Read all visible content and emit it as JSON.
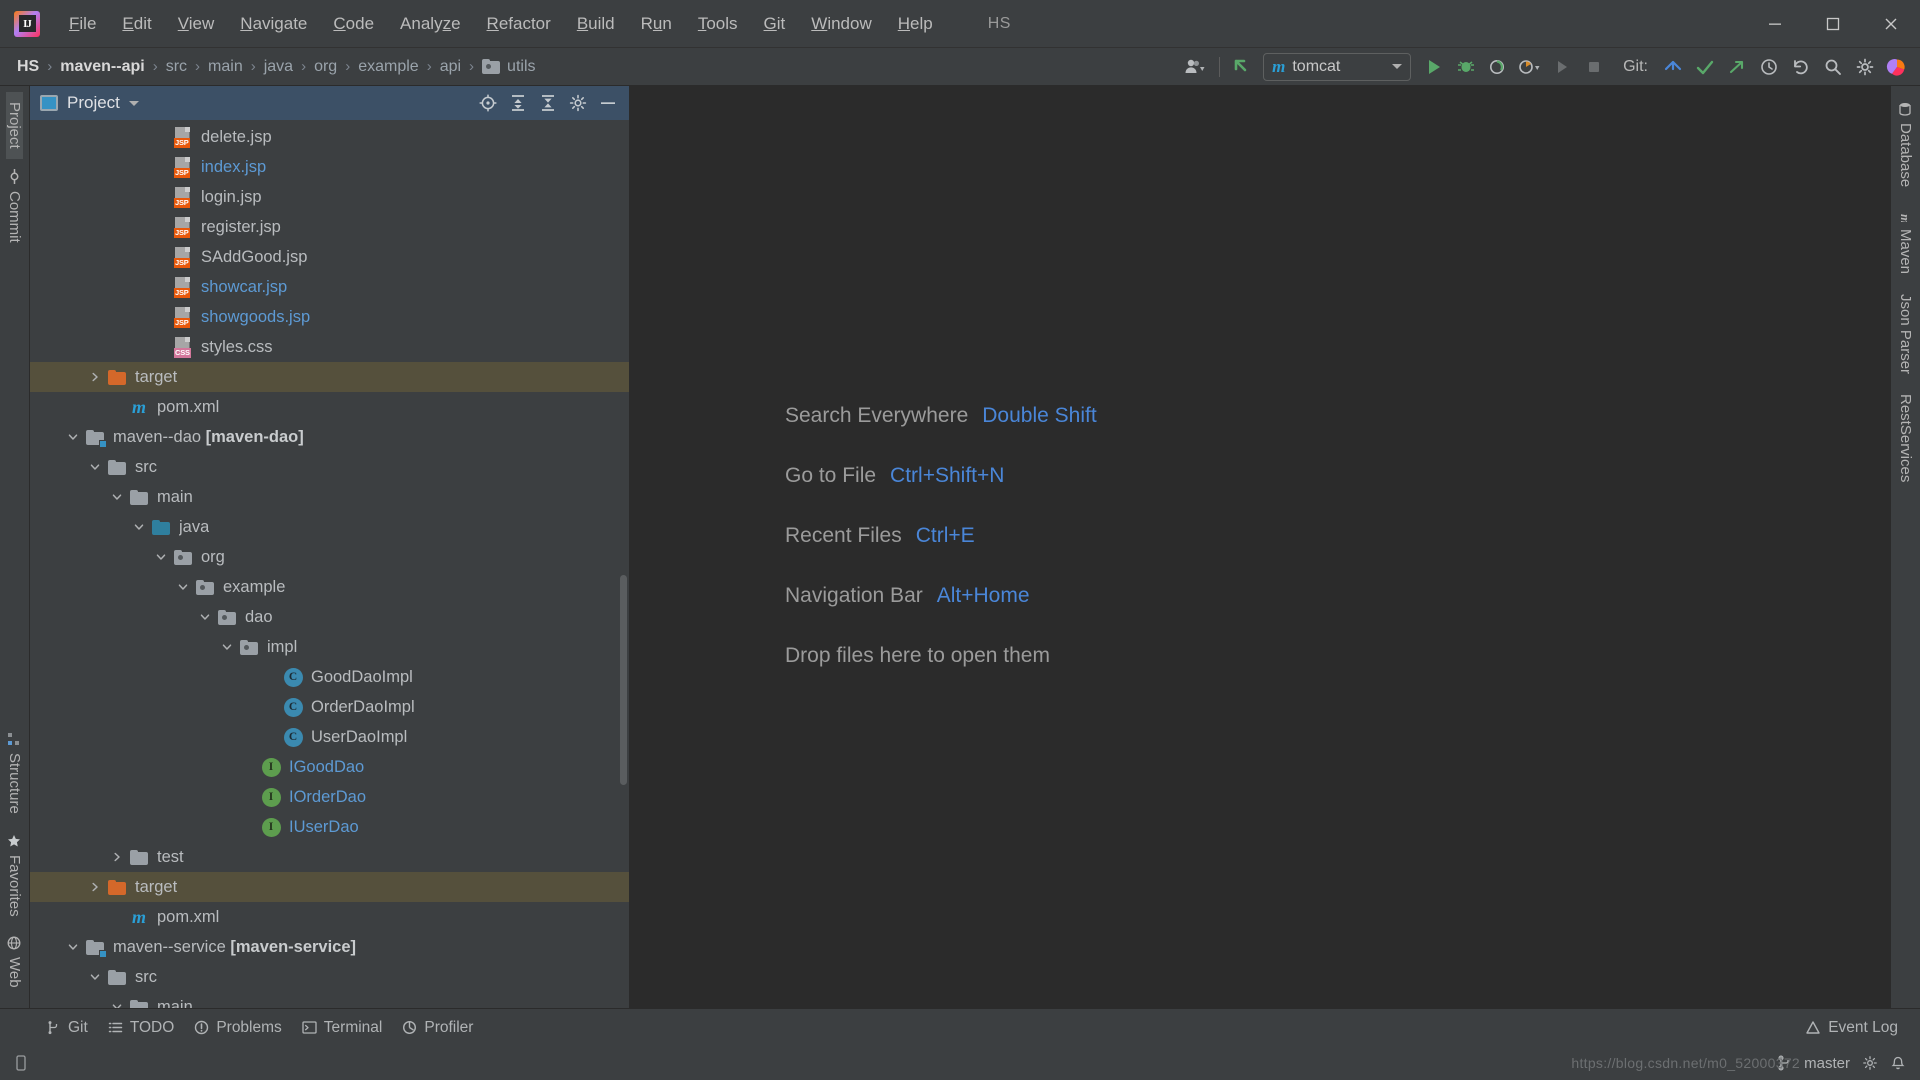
{
  "app": {
    "logo_text": "IJ",
    "project_name": "HS"
  },
  "menubar": {
    "items": [
      {
        "label": "File",
        "mnemonic": "F"
      },
      {
        "label": "Edit",
        "mnemonic": "E"
      },
      {
        "label": "View",
        "mnemonic": "V"
      },
      {
        "label": "Navigate",
        "mnemonic": "N"
      },
      {
        "label": "Code",
        "mnemonic": "C"
      },
      {
        "label": "Analyze",
        "mnemonic": "z"
      },
      {
        "label": "Refactor",
        "mnemonic": "R"
      },
      {
        "label": "Build",
        "mnemonic": "B"
      },
      {
        "label": "Run",
        "mnemonic": "u"
      },
      {
        "label": "Tools",
        "mnemonic": "T"
      },
      {
        "label": "Git",
        "mnemonic": "G"
      },
      {
        "label": "Window",
        "mnemonic": "W"
      },
      {
        "label": "Help",
        "mnemonic": "H"
      }
    ],
    "window_controls": {
      "minimize": "─",
      "maximize": "❐",
      "close": "✕"
    }
  },
  "navbar": {
    "breadcrumbs": [
      {
        "label": "HS",
        "style": "strong"
      },
      {
        "label": "maven--api",
        "style": "strong"
      },
      {
        "label": "src",
        "style": "dim"
      },
      {
        "label": "main",
        "style": "dim"
      },
      {
        "label": "java",
        "style": "dim"
      },
      {
        "label": "org",
        "style": "dim"
      },
      {
        "label": "example",
        "style": "dim"
      },
      {
        "label": "api",
        "style": "dim"
      },
      {
        "label": "utils",
        "style": "dim",
        "icon": "folder-icon"
      }
    ],
    "separator": "›",
    "run_config": {
      "name": "tomcat",
      "icon": "maven-m-icon"
    },
    "git_label": "Git:",
    "icons": [
      "user-dropdown-icon",
      "update-project-icon",
      "run-icon",
      "debug-icon",
      "run-with-coverage-icon",
      "profile-icon",
      "rerun-icon",
      "stop-icon",
      "git-update-icon",
      "git-commit-icon",
      "git-push-icon",
      "history-icon",
      "rollback-icon",
      "search-icon",
      "settings-icon",
      "ide-icon"
    ]
  },
  "left_rail": {
    "top_items": [
      "Project",
      "Commit"
    ],
    "bottom_items": [
      "Structure",
      "Favorites",
      "Web"
    ]
  },
  "right_rail": {
    "items": [
      "Database",
      "Maven",
      "Json Parser",
      "RestServices"
    ]
  },
  "project_window": {
    "title": "Project",
    "tools": [
      "locate-icon",
      "expand-all-icon",
      "collapse-all-icon",
      "settings-icon",
      "hide-icon"
    ],
    "tree": [
      {
        "label": "delete.jsp",
        "indent": 5,
        "icon": "jsp-file-icon",
        "arrow": "none",
        "color": "grey"
      },
      {
        "label": "index.jsp",
        "indent": 5,
        "icon": "jsp-file-icon",
        "arrow": "none",
        "color": "blue"
      },
      {
        "label": "login.jsp",
        "indent": 5,
        "icon": "jsp-file-icon",
        "arrow": "none",
        "color": "grey"
      },
      {
        "label": "register.jsp",
        "indent": 5,
        "icon": "jsp-file-icon",
        "arrow": "none",
        "color": "grey"
      },
      {
        "label": "SAddGood.jsp",
        "indent": 5,
        "icon": "jsp-file-icon",
        "arrow": "none",
        "color": "grey"
      },
      {
        "label": "showcar.jsp",
        "indent": 5,
        "icon": "jsp-file-icon",
        "arrow": "none",
        "color": "blue"
      },
      {
        "label": "showgoods.jsp",
        "indent": 5,
        "icon": "jsp-file-icon",
        "arrow": "none",
        "color": "blue"
      },
      {
        "label": "styles.css",
        "indent": 5,
        "icon": "css-file-icon",
        "arrow": "none",
        "color": "grey"
      },
      {
        "label": "target",
        "indent": 2,
        "icon": "folder-orange-icon",
        "arrow": "collapsed",
        "color": "grey",
        "highlighted": true
      },
      {
        "label": "pom.xml",
        "indent": 3,
        "icon": "maven-m-icon",
        "arrow": "none",
        "color": "grey"
      },
      {
        "label": "maven--dao ",
        "bold": "[maven-dao]",
        "indent": 1,
        "icon": "module-icon",
        "arrow": "expanded",
        "color": "grey"
      },
      {
        "label": "src",
        "indent": 2,
        "icon": "folder-icon",
        "arrow": "expanded",
        "color": "grey"
      },
      {
        "label": "main",
        "indent": 3,
        "icon": "folder-icon",
        "arrow": "expanded",
        "color": "grey"
      },
      {
        "label": "java",
        "indent": 4,
        "icon": "folder-blue-icon",
        "arrow": "expanded",
        "color": "grey"
      },
      {
        "label": "org",
        "indent": 5,
        "icon": "package-icon",
        "arrow": "expanded",
        "color": "grey"
      },
      {
        "label": "example",
        "indent": 6,
        "icon": "package-icon",
        "arrow": "expanded",
        "color": "grey"
      },
      {
        "label": "dao",
        "indent": 7,
        "icon": "package-icon",
        "arrow": "expanded",
        "color": "grey"
      },
      {
        "label": "impl",
        "indent": 8,
        "icon": "package-icon",
        "arrow": "expanded",
        "color": "grey"
      },
      {
        "label": "GoodDaoImpl",
        "indent": 10,
        "icon": "class-icon",
        "arrow": "none",
        "color": "grey"
      },
      {
        "label": "OrderDaoImpl",
        "indent": 10,
        "icon": "class-icon",
        "arrow": "none",
        "color": "grey"
      },
      {
        "label": "UserDaoImpl",
        "indent": 10,
        "icon": "class-icon",
        "arrow": "none",
        "color": "grey"
      },
      {
        "label": "IGoodDao",
        "indent": 9,
        "icon": "interface-icon",
        "arrow": "none",
        "color": "blue"
      },
      {
        "label": "IOrderDao",
        "indent": 9,
        "icon": "interface-icon",
        "arrow": "none",
        "color": "blue"
      },
      {
        "label": "IUserDao",
        "indent": 9,
        "icon": "interface-icon",
        "arrow": "none",
        "color": "blue"
      },
      {
        "label": "test",
        "indent": 3,
        "icon": "folder-icon",
        "arrow": "collapsed",
        "color": "grey"
      },
      {
        "label": "target",
        "indent": 2,
        "icon": "folder-orange-icon",
        "arrow": "collapsed",
        "color": "grey",
        "highlighted": true
      },
      {
        "label": "pom.xml",
        "indent": 3,
        "icon": "maven-m-icon",
        "arrow": "none",
        "color": "grey"
      },
      {
        "label": "maven--service ",
        "bold": "[maven-service]",
        "indent": 1,
        "icon": "module-icon",
        "arrow": "expanded",
        "color": "grey"
      },
      {
        "label": "src",
        "indent": 2,
        "icon": "folder-icon",
        "arrow": "expanded",
        "color": "grey"
      },
      {
        "label": "main",
        "indent": 3,
        "icon": "folder-icon",
        "arrow": "expanded",
        "color": "grey"
      }
    ]
  },
  "editor": {
    "hints": [
      {
        "label": "Search Everywhere",
        "key": "Double Shift"
      },
      {
        "label": "Go to File",
        "key": "Ctrl+Shift+N"
      },
      {
        "label": "Recent Files",
        "key": "Ctrl+E"
      },
      {
        "label": "Navigation Bar",
        "key": "Alt+Home"
      },
      {
        "label": "Drop files here to open them",
        "key": ""
      }
    ]
  },
  "statusbar": {
    "items": [
      {
        "label": "Git",
        "icon": "git-branch-icon"
      },
      {
        "label": "TODO",
        "icon": "todo-icon"
      },
      {
        "label": "Problems",
        "icon": "problems-icon"
      },
      {
        "label": "Terminal",
        "icon": "terminal-icon"
      },
      {
        "label": "Profiler",
        "icon": "profiler-icon"
      }
    ],
    "right": [
      {
        "label": "Event Log",
        "icon": "event-log-icon"
      }
    ]
  },
  "bottombar": {
    "watermark": "https://blog.csdn.net/m0_52000372",
    "branch": "master"
  },
  "colors": {
    "accent_blue": "#4a86d8",
    "header_blue": "#3c5066",
    "highlight_olive": "#55503c",
    "orange": "#d4682a",
    "green": "#5d9d4e",
    "bg_dark": "#2b2b2b",
    "bg_panel": "#3c3f41"
  }
}
